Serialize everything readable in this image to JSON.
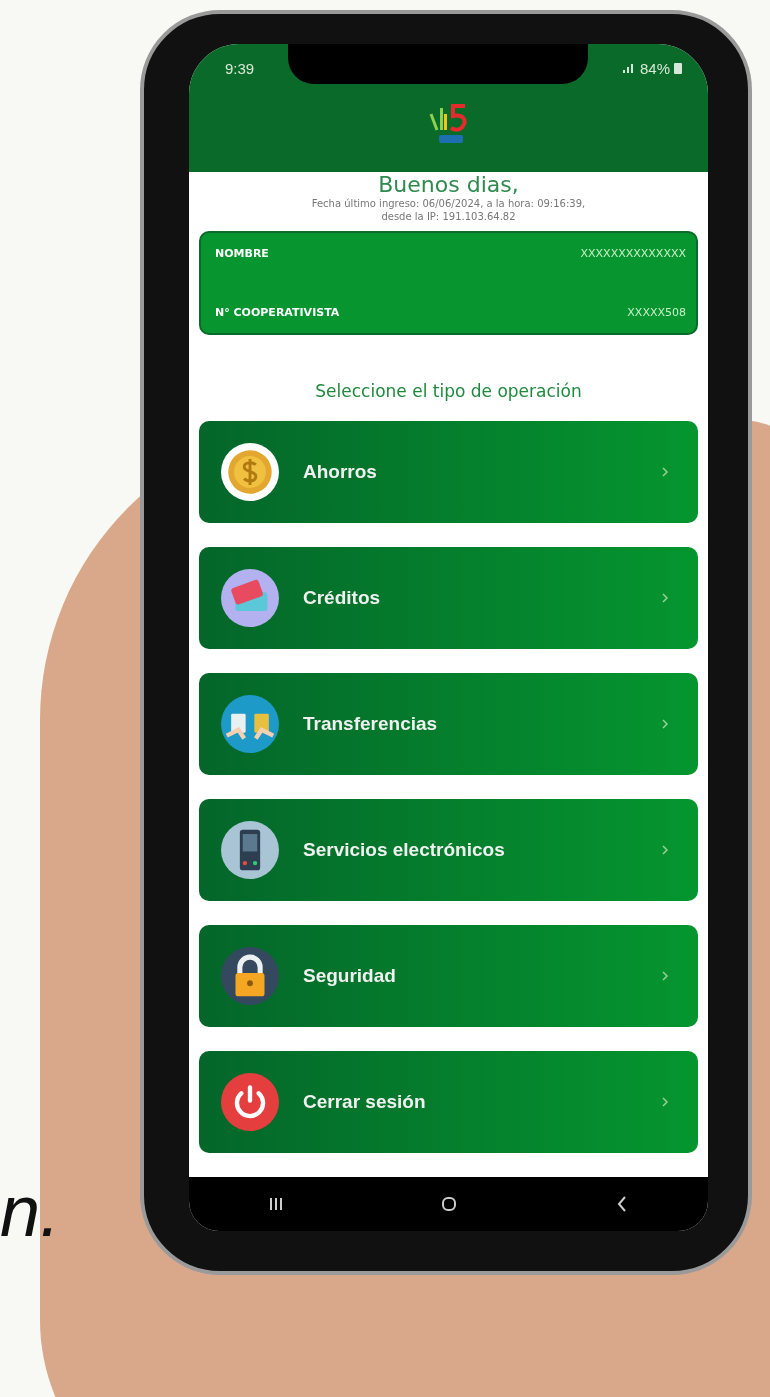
{
  "status_bar": {
    "time": "9:39",
    "battery": "84%"
  },
  "greeting": "Buenos dias,",
  "last_login": [
    "Fecha último ingreso: 06/06/2024, a la hora: 09:16:39,",
    "desde la IP: 191.103.64.82"
  ],
  "member_card": [
    {
      "label": "NOMBRE",
      "value": "XXXXXXXXXXXXXX"
    },
    {
      "label": "N° COOPERATIVISTA",
      "value": "XXXXX508"
    }
  ],
  "section_title": "Seleccione el tipo de operación",
  "menu": [
    {
      "label": "Ahorros",
      "kind": "coin"
    },
    {
      "label": "Créditos",
      "kind": "cards"
    },
    {
      "label": "Transferencias",
      "kind": "transfer"
    },
    {
      "label": "Servicios electrónicos",
      "kind": "phone"
    },
    {
      "label": "Seguridad",
      "kind": "lock"
    },
    {
      "label": "Cerrar sesión",
      "kind": "power"
    }
  ],
  "caption_fragment": "n."
}
